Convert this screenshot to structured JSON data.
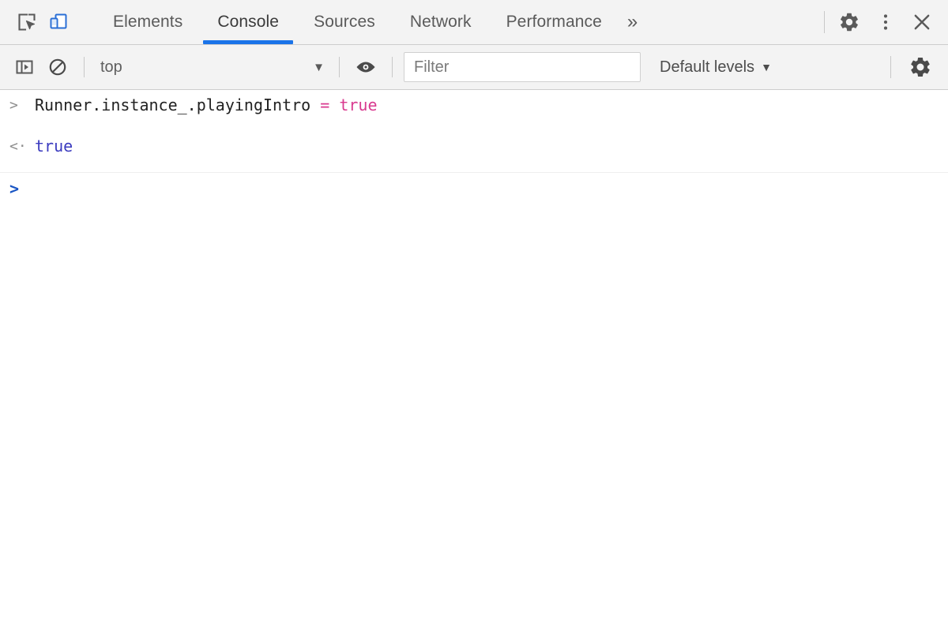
{
  "window": {
    "app": "Chrome DevTools"
  },
  "tabbar": {
    "inspect_icon": "inspect-element-icon",
    "device_icon": "device-toolbar-icon",
    "tabs": [
      {
        "label": "Elements",
        "active": false
      },
      {
        "label": "Console",
        "active": true
      },
      {
        "label": "Sources",
        "active": false
      },
      {
        "label": "Network",
        "active": false
      },
      {
        "label": "Performance",
        "active": false
      }
    ],
    "more_label": "»",
    "settings_icon": "gear-icon",
    "menu_icon": "kebab-menu-icon",
    "close_icon": "close-icon",
    "active_underline_color": "#1a73e8"
  },
  "console_toolbar": {
    "sidebar_toggle_icon": "console-sidebar-toggle-icon",
    "clear_icon": "clear-console-icon",
    "context": {
      "value": "top",
      "arrow": "▼"
    },
    "live_expression_icon": "eye-icon",
    "filter": {
      "value": "",
      "placeholder": "Filter"
    },
    "levels": {
      "label": "Default levels",
      "arrow": "▼"
    },
    "settings_icon": "gear-icon"
  },
  "console": {
    "messages": [
      {
        "type": "input",
        "gutter": ">",
        "expression": "Runner.instance_.playingIntro",
        "operator": " = ",
        "value": "true"
      },
      {
        "type": "result",
        "gutter": "<·",
        "value": "true"
      }
    ],
    "prompt": {
      "caret": ">",
      "value": ""
    }
  },
  "colors": {
    "accent": "#1a73e8",
    "toolbar_bg": "#f3f3f3",
    "border": "#cdcdcd",
    "token_pink": "#d93a8f",
    "result_blue": "#3b3bbf",
    "prompt_blue": "#1a56c4"
  }
}
